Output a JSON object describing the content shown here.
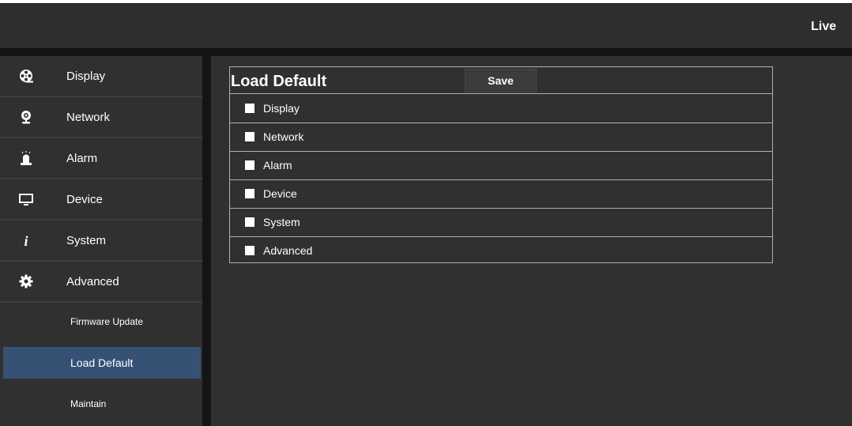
{
  "header": {
    "live_label": "Live"
  },
  "sidebar": {
    "items": [
      {
        "label": "Display",
        "icon": "film-reel-icon"
      },
      {
        "label": "Network",
        "icon": "webcam-icon"
      },
      {
        "label": "Alarm",
        "icon": "siren-icon"
      },
      {
        "label": "Device",
        "icon": "monitor-icon"
      },
      {
        "label": "System",
        "icon": "info-icon"
      },
      {
        "label": "Advanced",
        "icon": "gear-icon"
      }
    ],
    "subitems": [
      {
        "label": "Firmware Update",
        "active": false
      },
      {
        "label": "Load Default",
        "active": true
      },
      {
        "label": "Maintain",
        "active": false
      }
    ]
  },
  "main": {
    "title": "Load Default",
    "save_label": "Save",
    "options": [
      "Display",
      "Network",
      "Alarm",
      "Device",
      "System",
      "Advanced"
    ]
  },
  "colors": {
    "active_bg": "#355275",
    "panel_bg": "#303030"
  }
}
